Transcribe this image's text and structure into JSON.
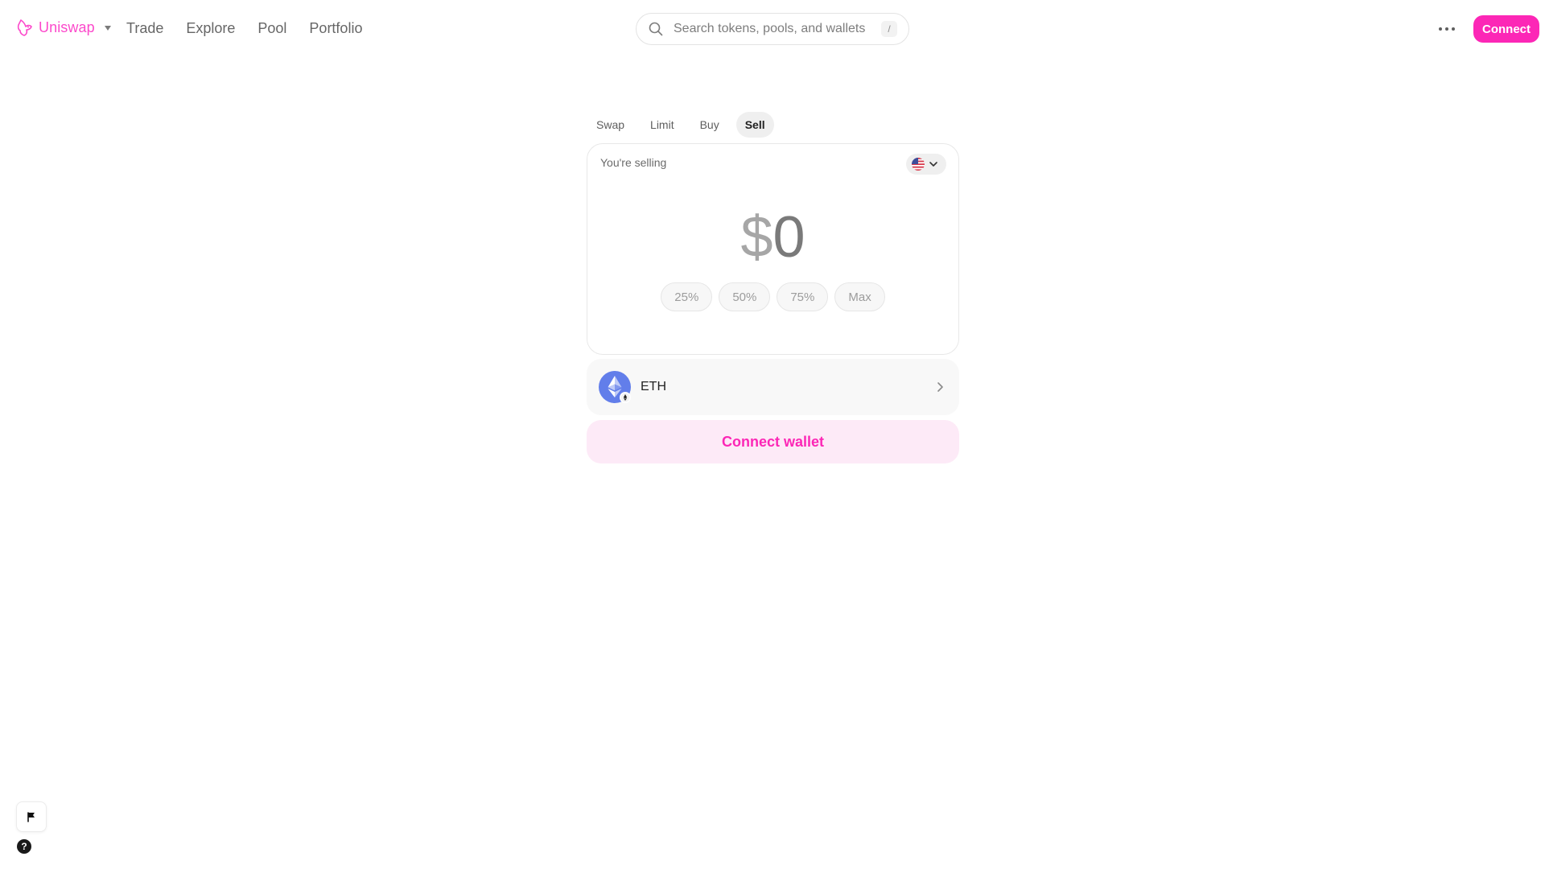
{
  "nav": {
    "brand": "Uniswap",
    "links": [
      "Trade",
      "Explore",
      "Pool",
      "Portfolio"
    ],
    "search_placeholder": "Search tokens, pools, and wallets",
    "search_shortcut": "/",
    "connect_label": "Connect"
  },
  "widget": {
    "tabs": [
      "Swap",
      "Limit",
      "Buy",
      "Sell"
    ],
    "active_tab": "Sell",
    "sell_label": "You're selling",
    "currency": "USD",
    "amount_symbol": "$",
    "amount_value": "0",
    "percent_options": [
      "25%",
      "50%",
      "75%",
      "Max"
    ],
    "token": {
      "symbol": "ETH",
      "icon": "ethereum-icon"
    },
    "connect_wallet_label": "Connect wallet"
  },
  "footer": {
    "help_glyph": "?"
  },
  "colors": {
    "brand_pink": "#fc27b6",
    "brand_pink_light": "#fdeaf7",
    "eth_blue": "#627eea"
  }
}
